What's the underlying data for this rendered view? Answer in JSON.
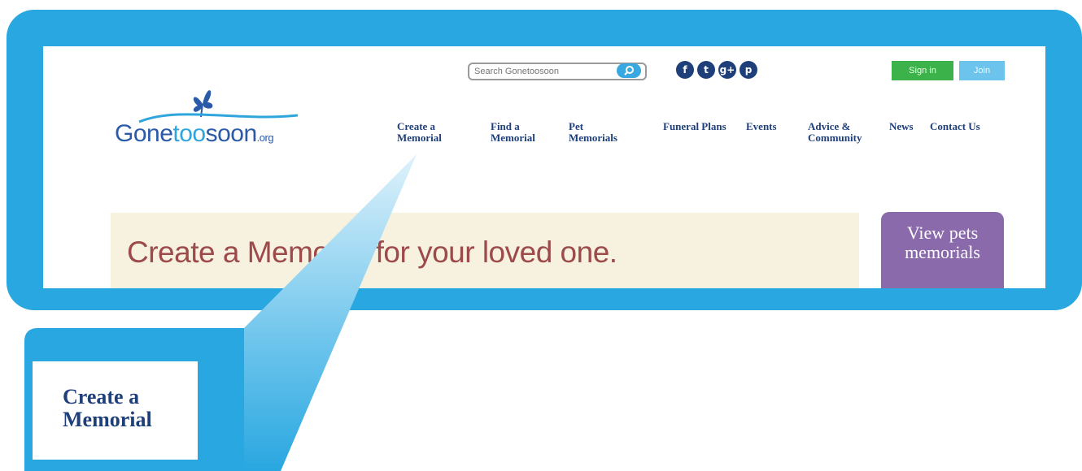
{
  "brand": {
    "name_part1": "Gone",
    "name_part2": "too",
    "name_part3": "soon",
    "name_suffix": ".org"
  },
  "header": {
    "search_placeholder": "Search Gonetoosoon",
    "social": [
      {
        "icon": "facebook-icon",
        "glyph": "f"
      },
      {
        "icon": "twitter-icon",
        "glyph": "t"
      },
      {
        "icon": "googleplus-icon",
        "glyph": "g+"
      },
      {
        "icon": "pinterest-icon",
        "glyph": "p"
      }
    ],
    "signin_label": "Sign in",
    "join_label": "Join"
  },
  "nav": [
    {
      "label": "Create a\nMemorial"
    },
    {
      "label": "Find a\nMemorial"
    },
    {
      "label": "Pet\nMemorials"
    },
    {
      "label": "Funeral Plans"
    },
    {
      "label": "Events"
    },
    {
      "label": "Advice &\nCommunity"
    },
    {
      "label": "News"
    },
    {
      "label": "Contact Us"
    }
  ],
  "hero": {
    "headline": "Create a Memorial for your loved one."
  },
  "pets_promo": {
    "label": "View pets memorials"
  },
  "callout": {
    "label": "Create a\nMemorial"
  },
  "colors": {
    "frame_blue": "#29a7e0",
    "nav_text": "#1f3f7a",
    "hero_bg": "#f7f1df",
    "hero_text": "#9c4a4a",
    "signin_green": "#3cb34a",
    "join_blue": "#6cc4ec",
    "pets_purple": "#8a6aaa"
  }
}
